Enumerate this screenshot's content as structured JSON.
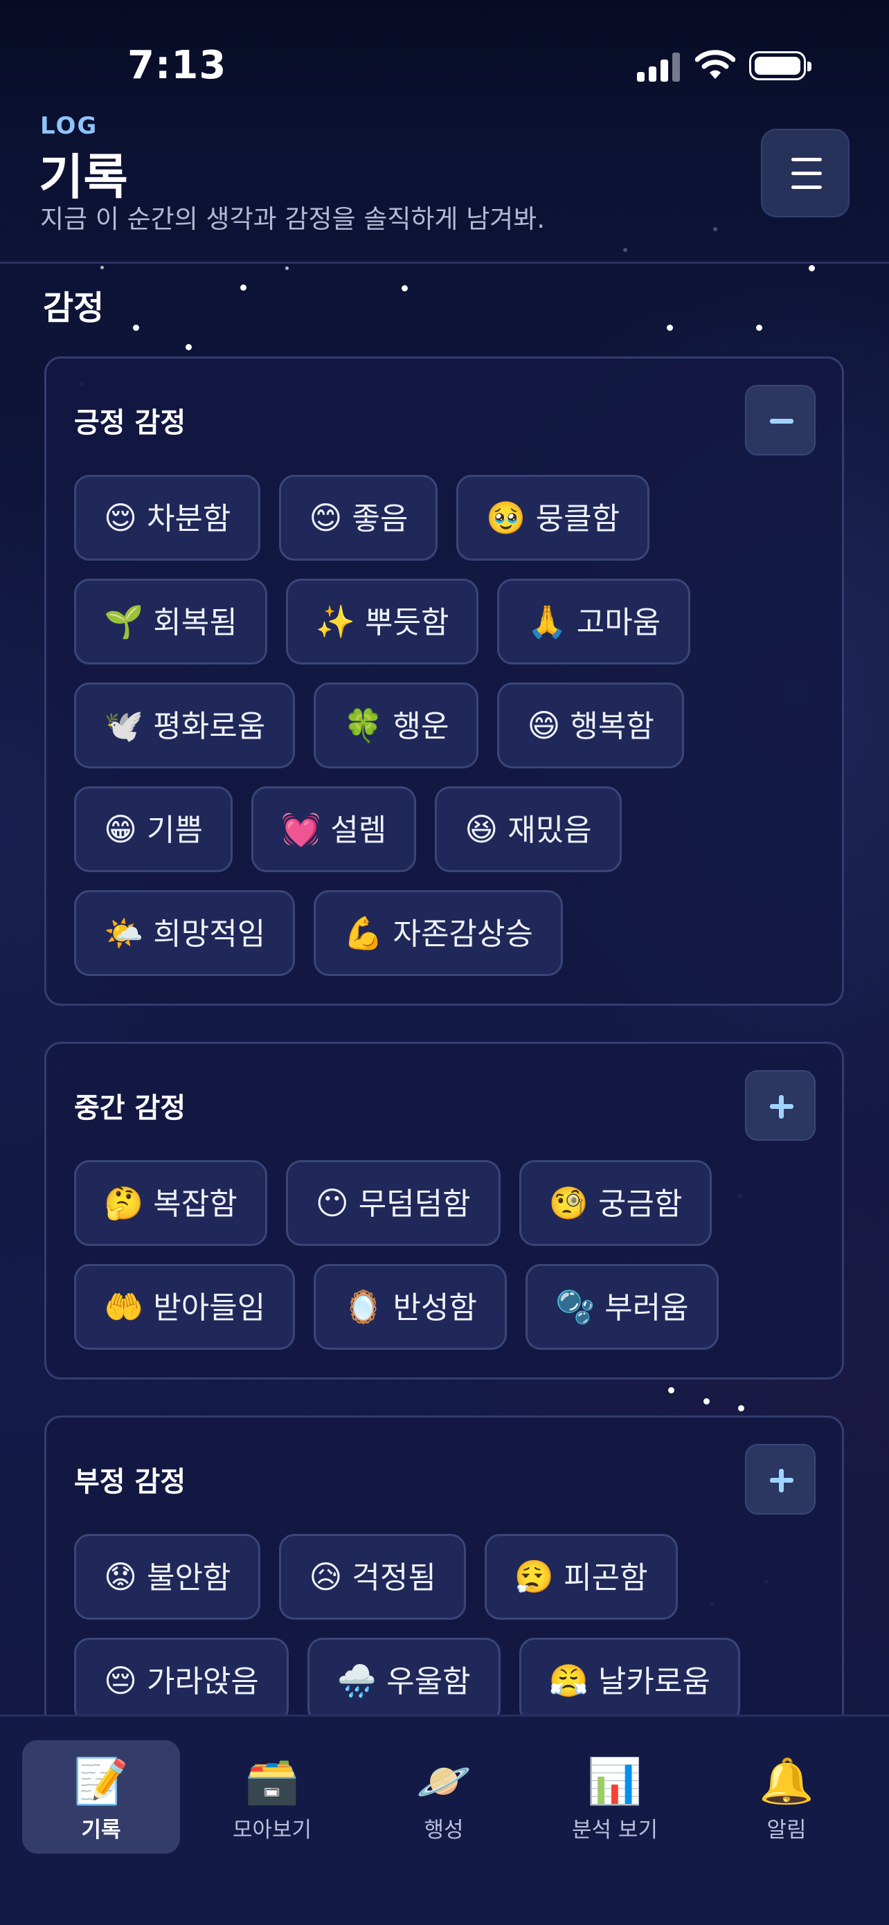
{
  "status_bar": {
    "time": "7:13"
  },
  "header": {
    "kicker": "LOG",
    "title": "기록",
    "subtitle": "지금 이 순간의 생각과 감정을 솔직하게 남겨봐.",
    "menu_icon": "hamburger-menu-icon"
  },
  "section_title": "감정",
  "groups": [
    {
      "title": "긍정 감정",
      "expanded": true,
      "toggle": "minus",
      "chips": [
        {
          "emoji": "😌",
          "label": "차분함"
        },
        {
          "emoji": "😊",
          "label": "좋음"
        },
        {
          "emoji": "🥹",
          "label": "뭉클함"
        },
        {
          "emoji": "🌱",
          "label": "회복됨"
        },
        {
          "emoji": "✨",
          "label": "뿌듯함"
        },
        {
          "emoji": "🙏",
          "label": "고마움"
        },
        {
          "emoji": "🕊️",
          "label": "평화로움"
        },
        {
          "emoji": "🍀",
          "label": "행운"
        },
        {
          "emoji": "😄",
          "label": "행복함"
        },
        {
          "emoji": "😁",
          "label": "기쁨"
        },
        {
          "emoji": "💓",
          "label": "설렘"
        },
        {
          "emoji": "😆",
          "label": "재밌음"
        },
        {
          "emoji": "🌤️",
          "label": "희망적임"
        },
        {
          "emoji": "💪",
          "label": "자존감상승"
        }
      ]
    },
    {
      "title": "중간 감정",
      "expanded": false,
      "toggle": "plus",
      "chips": [
        {
          "emoji": "🤔",
          "label": "복잡함"
        },
        {
          "emoji": "😶",
          "label": "무덤덤함"
        },
        {
          "emoji": "🧐",
          "label": "궁금함"
        },
        {
          "emoji": "🤲",
          "label": "받아들임"
        },
        {
          "emoji": "🪞",
          "label": "반성함"
        },
        {
          "emoji": "🫧",
          "label": "부러움"
        }
      ]
    },
    {
      "title": "부정 감정",
      "expanded": false,
      "toggle": "plus",
      "chips": [
        {
          "emoji": "😟",
          "label": "불안함"
        },
        {
          "emoji": "😥",
          "label": "걱정됨"
        },
        {
          "emoji": "😮‍💨",
          "label": "피곤함"
        },
        {
          "emoji": "😔",
          "label": "가라앉음"
        },
        {
          "emoji": "🌧️",
          "label": "우울함"
        },
        {
          "emoji": "😤",
          "label": "날카로움"
        }
      ]
    }
  ],
  "nav": [
    {
      "icon": "📝",
      "label": "기록",
      "active": true
    },
    {
      "icon": "🗃️",
      "label": "모아보기",
      "active": false
    },
    {
      "icon": "🪐",
      "label": "행성",
      "active": false
    },
    {
      "icon": "📊",
      "label": "분석 보기",
      "active": false
    },
    {
      "icon": "🔔",
      "label": "알림",
      "active": false
    }
  ]
}
